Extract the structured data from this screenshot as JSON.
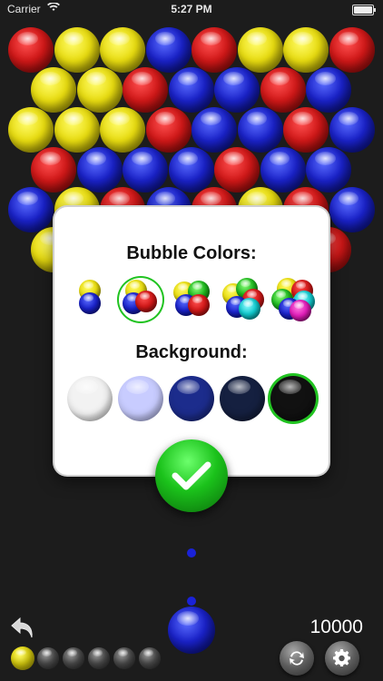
{
  "status_bar": {
    "carrier": "Carrier",
    "time": "5:27 PM"
  },
  "board": {
    "rows": [
      [
        "red",
        "yellow",
        "yellow",
        "blue",
        "red",
        "yellow",
        "yellow",
        "red"
      ],
      [
        "yellow",
        "yellow",
        "red",
        "blue",
        "blue",
        "red",
        "blue"
      ],
      [
        "yellow",
        "yellow",
        "yellow",
        "red",
        "blue",
        "blue",
        "red",
        "blue"
      ],
      [
        "red",
        "blue",
        "blue",
        "blue",
        "red",
        "blue",
        "blue"
      ],
      [
        "blue",
        "yellow",
        "red",
        "blue",
        "red",
        "yellow",
        "red",
        "blue"
      ],
      [
        "yellow",
        "",
        "",
        "",
        "",
        "",
        "red"
      ]
    ]
  },
  "dialog": {
    "colors_title": "Bubble Colors:",
    "background_title": "Background:",
    "color_options": [
      {
        "count": 2,
        "balls": [
          "yellow",
          "blue"
        ]
      },
      {
        "count": 3,
        "balls": [
          "yellow",
          "blue",
          "red"
        ],
        "selected": true
      },
      {
        "count": 4,
        "balls": [
          "yellow",
          "green",
          "blue",
          "red"
        ]
      },
      {
        "count": 5,
        "balls": [
          "yellow",
          "green",
          "red",
          "blue",
          "cyan"
        ]
      },
      {
        "count": 6,
        "balls": [
          "yellow",
          "red",
          "green",
          "cyan",
          "blue",
          "magenta"
        ]
      }
    ],
    "background_options": [
      {
        "color": "#f2f2f2"
      },
      {
        "color": "#c8ccff"
      },
      {
        "color": "#1c2c8c"
      },
      {
        "color": "#152040"
      },
      {
        "color": "#111111",
        "selected": true
      }
    ],
    "confirm_icon": "checkmark-icon"
  },
  "shooter": {
    "color": "blue"
  },
  "score": "10000",
  "next_queue": {
    "filled": [
      "yellow"
    ],
    "empty_slots": 5
  },
  "icons": {
    "undo": "undo-arrow-icon",
    "restart": "refresh-icon",
    "settings": "gear-icon"
  },
  "colors": {
    "accent_green": "#21c321",
    "board_background": "#1c1c1c"
  }
}
